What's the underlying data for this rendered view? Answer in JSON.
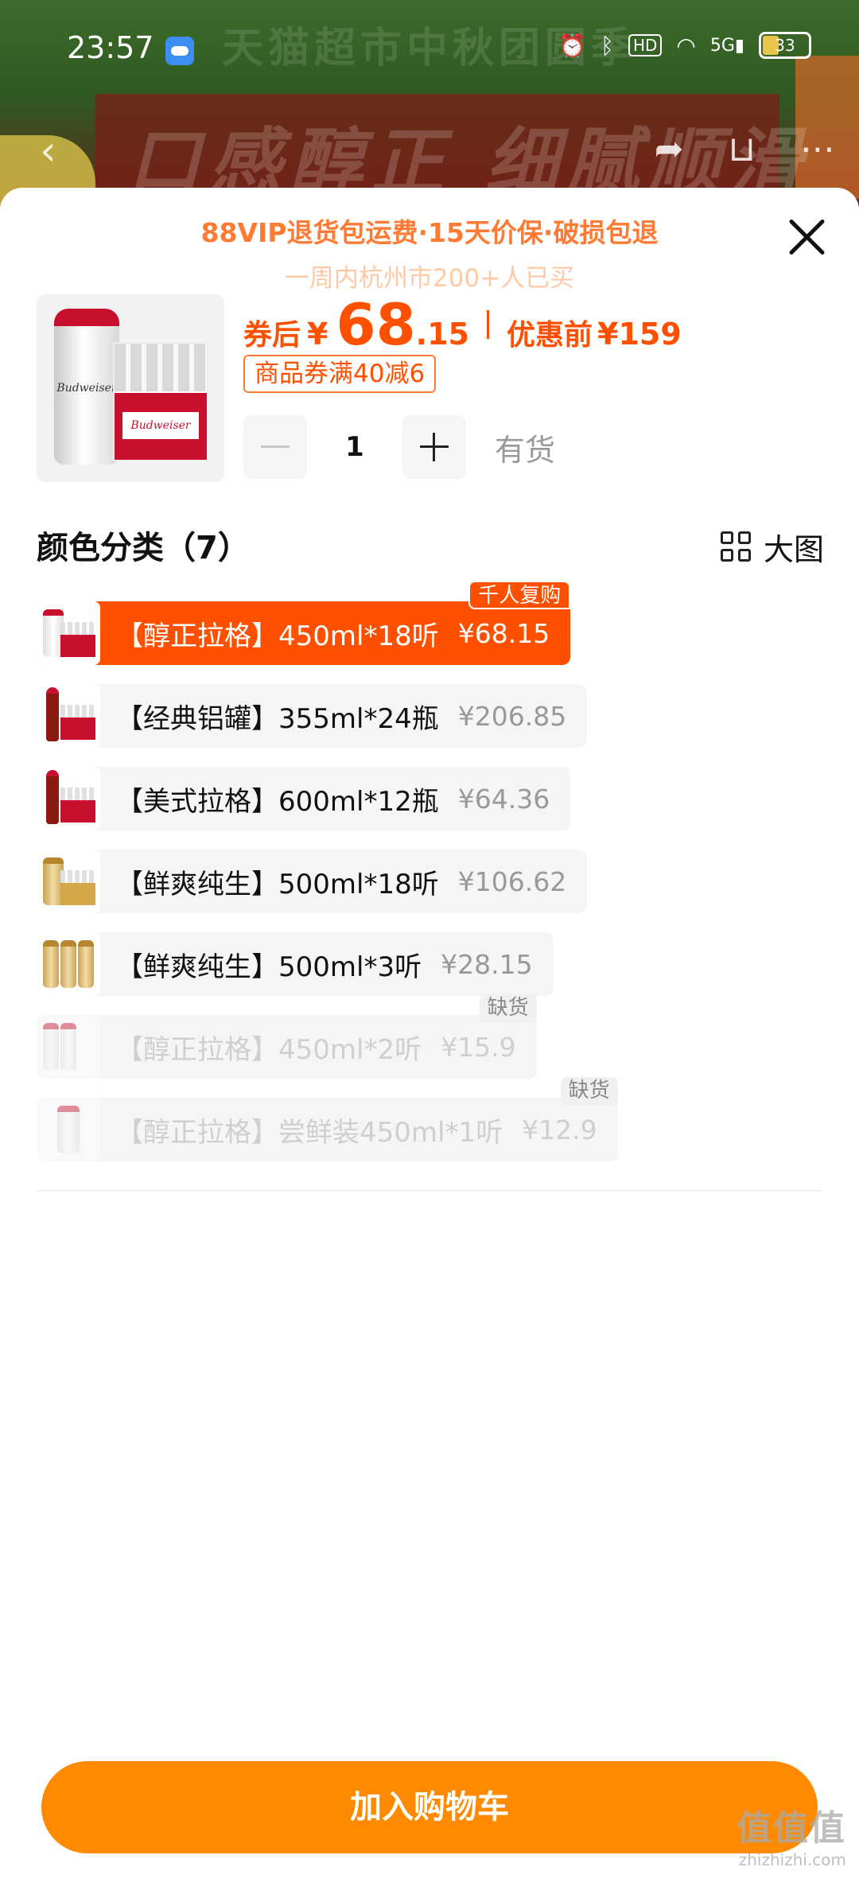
{
  "status_bar": {
    "time": "23:57",
    "network": "5G",
    "hd_label": "HD",
    "battery": "33",
    "icons": [
      "weather-icon",
      "alarm-icon",
      "bluetooth-icon",
      "hd-icon",
      "wifi-icon",
      "signal-icon",
      "battery-icon"
    ]
  },
  "background_page": {
    "banner_title": "天猫超市中秋团圆季",
    "slogan": "口感醇正 细腻顺滑"
  },
  "sheet": {
    "promo": "88VIP退货包运费·15天价保·破损包退",
    "buyers": "一周内杭州市200+人已买",
    "price_prefix": "券后",
    "currency": "¥",
    "price_int": "68",
    "price_dec": ".15",
    "orig_prefix": "优惠前",
    "orig_price": "¥159",
    "coupon": "商品券满40减6",
    "quantity": "1",
    "stock": "有货",
    "category_title": "颜色分类（7）",
    "big_view": "大图",
    "add_to_cart": "加入购物车"
  },
  "variants": [
    {
      "label": "【醇正拉格】450ml*18听",
      "price": "¥68.15",
      "badge": "千人复购",
      "state": "selected"
    },
    {
      "label": "【经典铝罐】355ml*24瓶",
      "price": "¥206.85",
      "badge": "",
      "state": "normal"
    },
    {
      "label": "【美式拉格】600ml*12瓶",
      "price": "¥64.36",
      "badge": "",
      "state": "normal"
    },
    {
      "label": "【鲜爽纯生】500ml*18听",
      "price": "¥106.62",
      "badge": "",
      "state": "normal"
    },
    {
      "label": "【鲜爽纯生】500ml*3听",
      "price": "¥28.15",
      "badge": "",
      "state": "normal"
    },
    {
      "label": "【醇正拉格】450ml*2听",
      "price": "¥15.9",
      "badge": "缺货",
      "state": "soldout"
    },
    {
      "label": "【醇正拉格】尝鲜装450ml*1听",
      "price": "¥12.9",
      "badge": "缺货",
      "state": "soldout"
    }
  ],
  "watermark": {
    "logo": "值值值",
    "domain": "zhizhizhi.com"
  },
  "colors": {
    "accent": "#ff5000",
    "cart_button": "#ff8a00",
    "promo": "#ff7a33"
  }
}
